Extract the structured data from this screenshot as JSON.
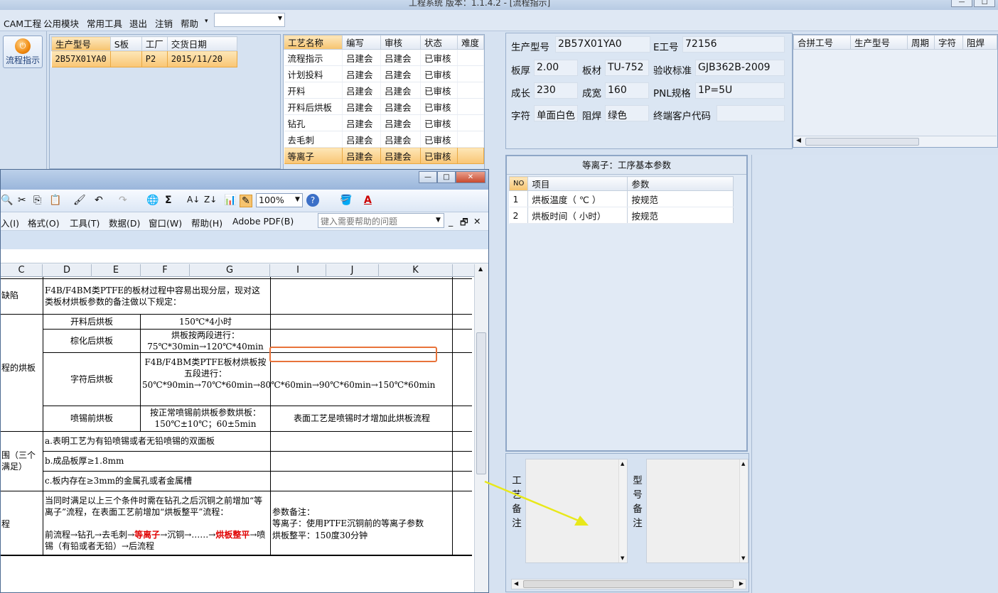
{
  "titlebar": {
    "title": "工程系统   版本：1.1.4.2 - [流程指示]"
  },
  "menubar": {
    "items": [
      "CAM工程",
      "公用模块",
      "常用工具",
      "退出",
      "注销",
      "帮助"
    ],
    "dropdown_arrow": "▾",
    "combo_value": ""
  },
  "toolbar_left": {
    "flow_button": "流程指示"
  },
  "product_grid": {
    "headers": [
      "生产型号",
      "S板",
      "工厂",
      "交货日期"
    ],
    "rows": [
      [
        "2B57X01YA0",
        "",
        "P2",
        "2015/11/20"
      ]
    ]
  },
  "process_grid": {
    "headers": [
      "工艺名称",
      "编写",
      "审核",
      "状态",
      "难度"
    ],
    "rows": [
      [
        "流程指示",
        "吕建会",
        "吕建会",
        "已审核",
        ""
      ],
      [
        "计划投料",
        "吕建会",
        "吕建会",
        "已审核",
        ""
      ],
      [
        "开料",
        "吕建会",
        "吕建会",
        "已审核",
        ""
      ],
      [
        "开料后烘板",
        "吕建会",
        "吕建会",
        "已审核",
        ""
      ],
      [
        "钻孔",
        "吕建会",
        "吕建会",
        "已审核",
        ""
      ],
      [
        "去毛刺",
        "吕建会",
        "吕建会",
        "已审核",
        ""
      ],
      [
        "等离子",
        "吕建会",
        "吕建会",
        "已审核",
        ""
      ]
    ],
    "selected_index": 6
  },
  "info": {
    "model_label": "生产型号",
    "model_value": "2B57X01YA0",
    "eno_label": "E工号",
    "eno_value": "72156",
    "thick_label": "板厚",
    "thick_value": "2.00",
    "mat_label": "板材",
    "mat_value": "TU-752",
    "std_label": "验收标准",
    "std_value": "GJB362B-2009",
    "len_label": "成长",
    "len_value": "230",
    "wid_label": "成宽",
    "wid_value": "160",
    "pnl_label": "PNL规格",
    "pnl_value": "1P=5U",
    "char_label": "字符",
    "char_value": "单面白色",
    "mask_label": "阻焊",
    "mask_value": "绿色",
    "cust_label": "终端客户代码",
    "cust_value": ""
  },
  "merge_grid": {
    "headers": [
      "合拼工号",
      "生产型号",
      "周期",
      "字符",
      "阻焊"
    ]
  },
  "param_panel": {
    "title": "等离子：工序基本参数",
    "headers": [
      "NO",
      "项目",
      "参数"
    ],
    "rows": [
      [
        "1",
        "烘板温度（ ℃ ）",
        "按规范"
      ],
      [
        "2",
        "烘板时间（ 小时）",
        "按规范"
      ]
    ]
  },
  "notes": {
    "process_label": [
      "工",
      "艺",
      "备",
      "注"
    ],
    "model_label": [
      "型",
      "号",
      "备",
      "注"
    ]
  },
  "excel": {
    "title_buttons": [
      "—",
      "□",
      "✕"
    ],
    "toolbar": {
      "zoom": "100%",
      "sigma": "Σ",
      "help_q": "?"
    },
    "menu": [
      "入(I)",
      "格式(O)",
      "工具(T)",
      "数据(D)",
      "窗口(W)",
      "帮助(H)",
      "Adobe PDF(B)"
    ],
    "help_placeholder": "键入需要帮助的问题",
    "columns": [
      "C",
      "D",
      "E",
      "F",
      "G",
      "I",
      "J",
      "K"
    ],
    "sheet": {
      "c_defect": "缺陷",
      "intro": "F4B/F4BM类PTFE的板材过程中容易出现分层，现对这类板材烘板参数的备注做以下规定：",
      "c_bake": "程的烘板",
      "r1_name": "开料后烘板",
      "r1_val": "150℃*4小时",
      "r2_name": "棕化后烘板",
      "r2_val": "烘板按两段进行：75℃*30min→120℃*40min",
      "r3_name": "字符后烘板",
      "r3_val": "F4B/F4BM类PTFE板材烘板按五段进行：50℃*90min→70℃*60min→80℃*60min→90℃*60min→150℃*60min",
      "r4_name": "喷锡前烘板",
      "r4_val": "按正常喷锡前烘板参数烘板：150℃±10℃；60±5min",
      "r4_note": "表面工艺是喷锡时才增加此烘板流程",
      "c_range": "围（三个满足）",
      "ra": "a.表明工艺为有铅喷锡或者无铅喷锡的双面板",
      "rb": "b.成品板厚≥1.8mm",
      "rc": "c.板内存在≥3mm的金属孔或者金属槽",
      "c_flow": "程",
      "flow_text1": "当同时满足以上三个条件时需在钻孔之后沉铜之前增加“等离子”流程，在表面工艺前增加“烘板整平”流程：",
      "flow_text2a": "前流程→钻孔→去毛刺→",
      "flow_red1": "等离子",
      "flow_text2b": "→沉铜→……→",
      "flow_red2": "烘板整平",
      "flow_text2c": "→喷锡（有铅或者无铅）→后流程",
      "param_note_label": "参数备注：",
      "param_note_1": "等离子：使用PTFE沉铜前的等离子参数",
      "param_note_2": "烘板整平：150度30分钟"
    }
  },
  "colors": {
    "accent_orange": "#f9c574",
    "callout": "#e8733a",
    "arrow": "#e8e81a"
  }
}
